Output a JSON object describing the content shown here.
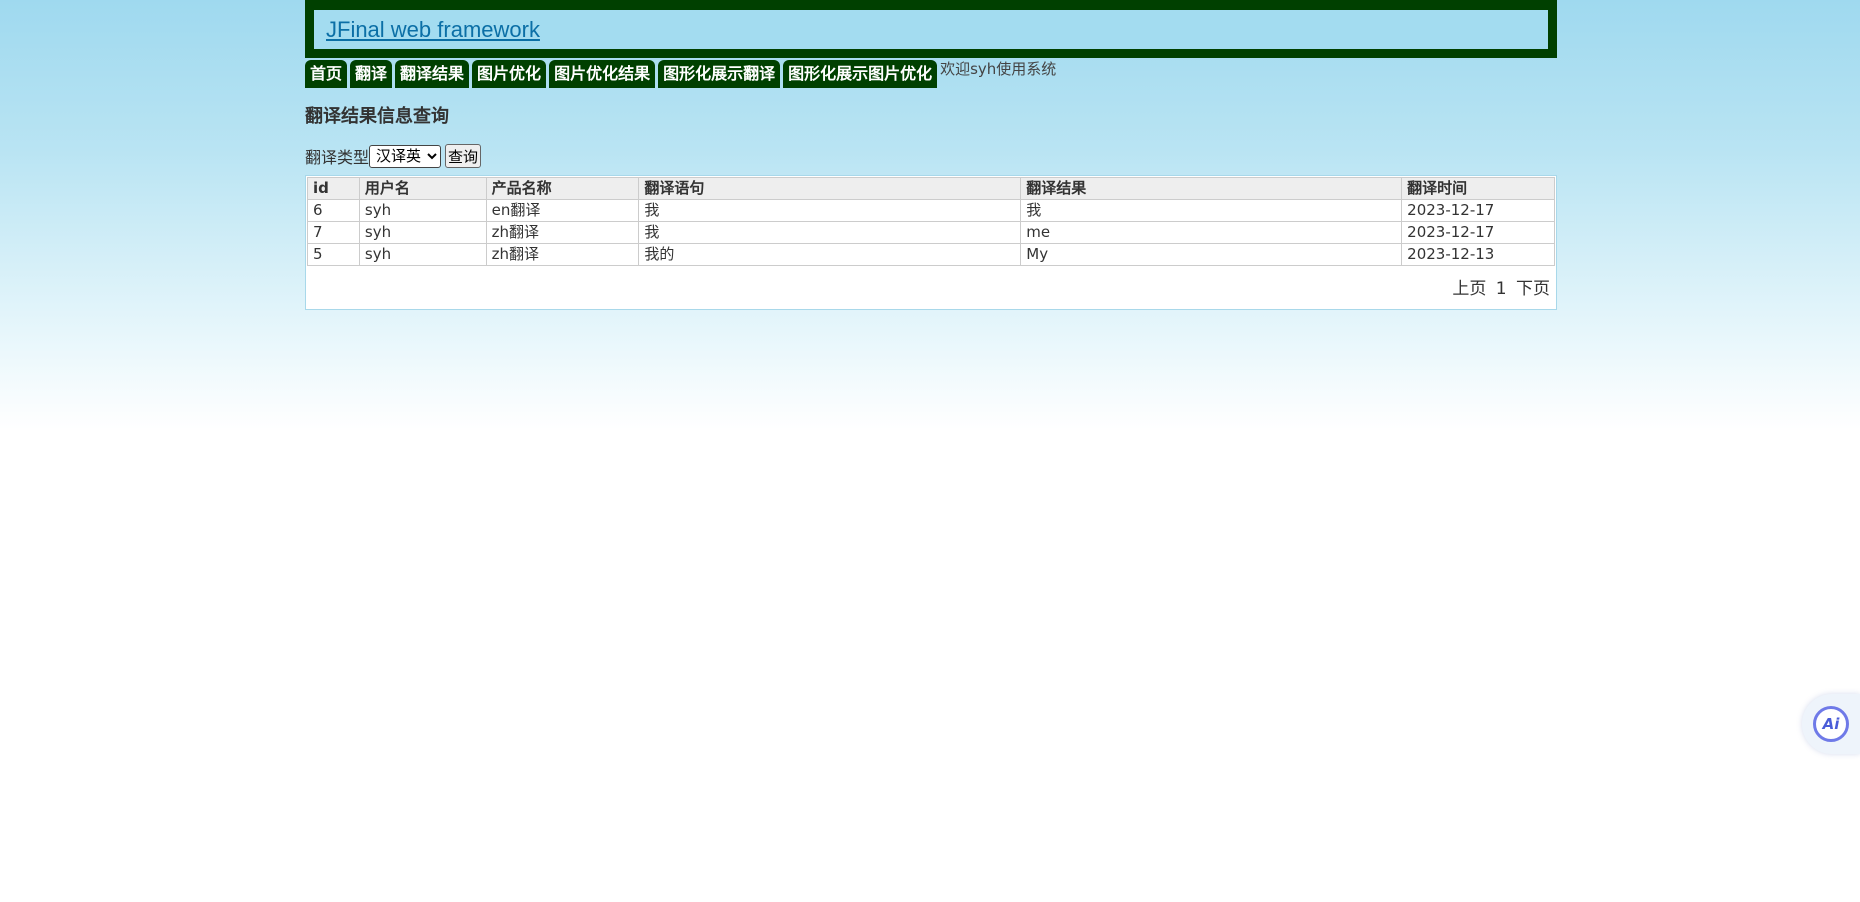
{
  "header": {
    "title": "JFinal web framework"
  },
  "nav": {
    "items": [
      {
        "label": "首页"
      },
      {
        "label": "翻译"
      },
      {
        "label": "翻译结果"
      },
      {
        "label": "图片优化"
      },
      {
        "label": "图片优化结果"
      },
      {
        "label": "图形化展示翻译"
      },
      {
        "label": "图形化展示图片优化"
      }
    ],
    "welcome": "欢迎syh使用系统"
  },
  "page": {
    "title": "翻译结果信息查询"
  },
  "filter": {
    "label": "翻译类型",
    "selected": "汉译英",
    "query_button": "查询"
  },
  "table": {
    "headers": [
      "id",
      "用户名",
      "产品名称",
      "翻译语句",
      "翻译结果",
      "翻译时间"
    ],
    "rows": [
      [
        "6",
        "syh",
        "en翻译",
        "我",
        "我",
        "2023-12-17"
      ],
      [
        "7",
        "syh",
        "zh翻译",
        "我",
        "me",
        "2023-12-17"
      ],
      [
        "5",
        "syh",
        "zh翻译",
        "我的",
        "My",
        "2023-12-13"
      ]
    ]
  },
  "pager": {
    "prev": "上页",
    "current": "1",
    "next": "下页"
  },
  "ai_widget": {
    "label": "Ai",
    "icon": "ai-assistant-icon"
  }
}
